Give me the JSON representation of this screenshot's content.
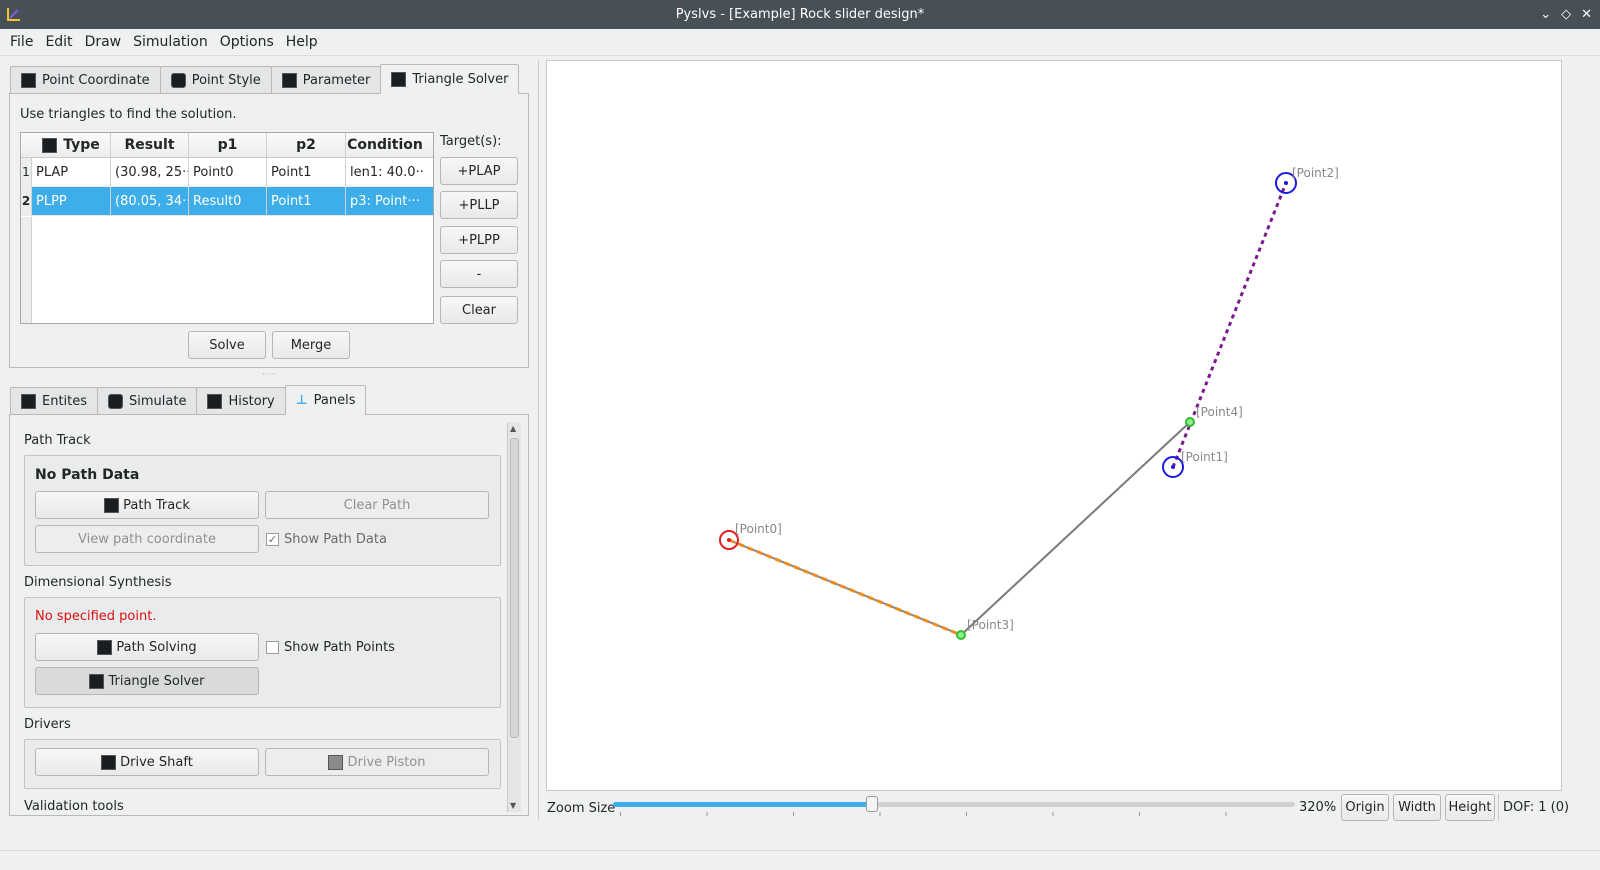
{
  "window": {
    "title": "Pyslvs - [Example] Rock slider design*"
  },
  "menu": [
    "File",
    "Edit",
    "Draw",
    "Simulation",
    "Options",
    "Help"
  ],
  "top_tabs": [
    "Point Coordinate",
    "Point Style",
    "Parameter",
    "Triangle Solver"
  ],
  "triangle_solver": {
    "description": "Use triangles to find the solution.",
    "targets_label": "Target(s):",
    "columns": [
      "Type",
      "Result",
      "p1",
      "p2",
      "Condition"
    ],
    "rows": [
      {
        "num": "1",
        "type": "PLAP",
        "result": "(30.98, 25···",
        "p1": "Point0",
        "p2": "Point1",
        "condition": "len1: 40.0···"
      },
      {
        "num": "2",
        "type": "PLPP",
        "result": "(80.05, 34···",
        "p1": "Result0",
        "p2": "Point1",
        "condition": "p3: Point···"
      }
    ],
    "side_buttons": [
      "+PLAP",
      "+PLLP",
      "+PLPP",
      "-",
      "Clear"
    ],
    "solve": "Solve",
    "merge": "Merge"
  },
  "bottom_tabs": [
    "Entites",
    "Simulate",
    "History",
    "Panels"
  ],
  "panels": {
    "path_track_title": "Path Track",
    "no_path_data": "No Path Data",
    "path_track_btn": "Path Track",
    "clear_path_btn": "Clear Path",
    "view_path_btn": "View path coordinate",
    "show_path_data": "Show Path Data",
    "dim_synth_title": "Dimensional Synthesis",
    "no_point": "No specified point.",
    "path_solving_btn": "Path Solving",
    "show_path_points": "Show Path Points",
    "triangle_solver_btn": "Triangle Solver",
    "drivers_title": "Drivers",
    "drive_shaft_btn": "Drive Shaft",
    "drive_piston_btn": "Drive Piston",
    "validation_title": "Validation tools"
  },
  "canvas": {
    "points": [
      "[Point0]",
      "[Point1]",
      "[Point2]",
      "[Point3]",
      "[Point4]"
    ]
  },
  "status": {
    "zoom_label": "Zoom Size",
    "zoom_value": "320%",
    "zoom_fraction": 0.38,
    "origin": "Origin",
    "width": "Width",
    "height": "Height",
    "dof": "DOF: 1 (0)"
  },
  "colors": {
    "accent": "#3daee9",
    "error": "#da1010",
    "titlebar": "#475057"
  }
}
